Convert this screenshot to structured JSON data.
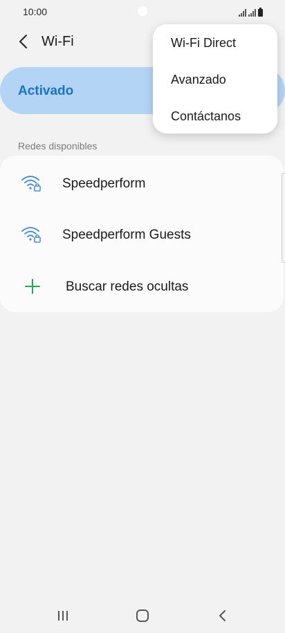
{
  "status_bar": {
    "time": "10:00"
  },
  "toolbar": {
    "title": "Wi-Fi"
  },
  "master_toggle": {
    "label": "Activado",
    "accent_color": "#1a73c9",
    "background_color": "#b4d4f6"
  },
  "networks": {
    "section_header": "Redes disponibles",
    "items": [
      {
        "name": "Speedperform",
        "icon": "wifi-lock-icon"
      },
      {
        "name": "Speedperform Guests",
        "icon": "wifi-lock-icon"
      }
    ],
    "add_label": "Buscar redes ocultas",
    "add_icon": "plus-icon",
    "add_icon_color": "#27a35a"
  },
  "overflow_menu": {
    "items": [
      {
        "label": "Wi-Fi Direct"
      },
      {
        "label": "Avanzado"
      },
      {
        "label": "Contáctanos"
      }
    ]
  },
  "nav_bar": {
    "recents_icon": "recents-icon",
    "home_icon": "home-icon",
    "back_icon": "back-icon"
  }
}
